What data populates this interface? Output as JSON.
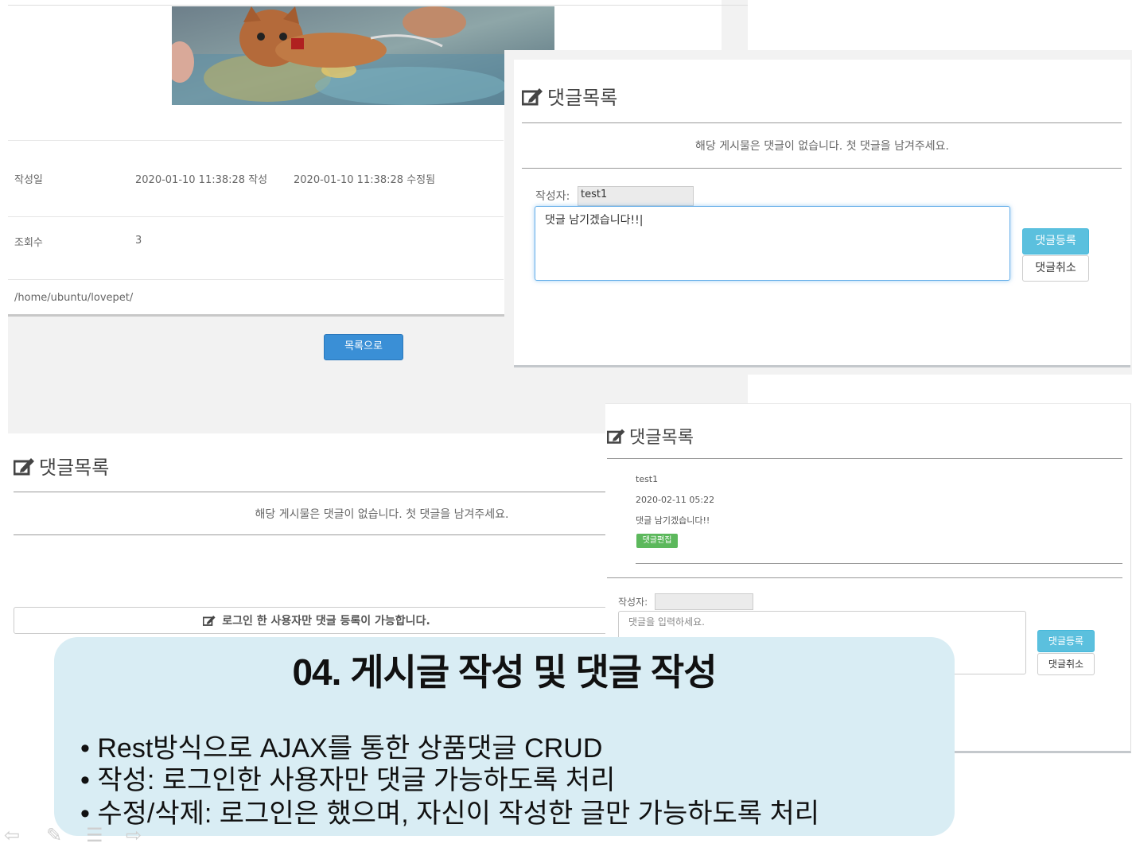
{
  "left_page": {
    "created_label": "작성일",
    "created_value": "2020-01-10 11:38:28 작성",
    "modified_value": "2020-01-10 11:38:28 수정됨",
    "views_label": "조회수",
    "views_value": "3",
    "path_text": "/home/ubuntu/lovepet/",
    "list_button": "목록으로"
  },
  "left_comments": {
    "title": "댓글목록",
    "empty_message": "해당 게시물은 댓글이 없습니다. 첫 댓글을 남겨주세요.",
    "login_notice": "로그인 한 사용자만 댓글 등록이 가능합니다."
  },
  "top_right_panel": {
    "title": "댓글목록",
    "empty_message": "해당 게시물은 댓글이 없습니다. 첫 댓글을 남겨주세요.",
    "writer_label": "작성자:",
    "writer_value": "test1",
    "comment_value": "댓글 남기겠습니다!!|",
    "submit_button": "댓글등록",
    "cancel_button": "댓글취소"
  },
  "bottom_right_panel": {
    "title": "댓글목록",
    "comment": {
      "author": "test1",
      "date": "2020-02-11 05:22",
      "text": "댓글 남기겠습니다!!",
      "edit_button": "댓글편집"
    },
    "writer_label": "작성자:",
    "writer_value": "",
    "placeholder": "댓글을 입력하세요.",
    "submit_button": "댓글등록",
    "cancel_button": "댓글취소"
  },
  "overlay": {
    "title": "04. 게시글 작성 및 댓글 작성",
    "bullets": [
      "• Rest방식으로 AJAX를 통한 상품댓글 CRUD",
      "• 작성: 로그인한 사용자만 댓글 가능하도록 처리",
      "• 수정/삭제: 로그인은 했으며, 자신이 작성한 글만 가능하도록 처리"
    ]
  },
  "icons": [
    "edit-icon",
    "prev-icon",
    "pen-icon",
    "menu-icon",
    "next-icon"
  ],
  "colors": {
    "primary_blue": "#3a8fd6",
    "info_cyan": "#5bc0de",
    "success_green": "#5cb85c",
    "overlay_bg": "#d9edf4"
  }
}
